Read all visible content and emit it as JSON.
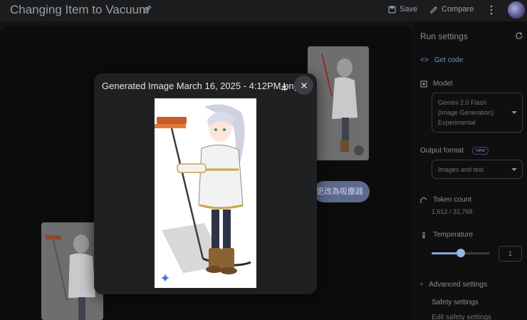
{
  "header": {
    "title": "Changing Item to Vacuum",
    "save_label": "Save",
    "compare_label": "Compare"
  },
  "chat": {
    "prompt_chip_text": "更改為吸塵器"
  },
  "run_settings": {
    "title": "Run settings",
    "get_code_label": "Get code",
    "model_label": "Model",
    "model_value_lines": [
      "Gemini 2.0 Flash",
      "(Image Generation)",
      "Experimental"
    ],
    "output_format_label": "Output format",
    "output_format_badge": "new",
    "output_format_value": "Images and text",
    "token_count_label": "Token count",
    "token_count_value": "1,612 / 32,768",
    "temperature_label": "Temperature",
    "temperature_value": "1",
    "temperature_fraction": 0.5,
    "advanced_settings_label": "Advanced settings",
    "safety_settings_label": "Safety settings",
    "edit_safety_settings_label": "Edit safety settings"
  },
  "modal": {
    "title": "Generated Image March 16, 2025 - 4:12PM.png"
  },
  "colors": {
    "accent_blue": "#6f8fc9",
    "chip_bg": "#5c6a8c",
    "modal_bg": "#1f2022"
  },
  "icons": [
    "edit-icon",
    "save-icon",
    "compare-icon",
    "more-icon",
    "refresh-icon",
    "code-icon",
    "model-icon",
    "token-icon",
    "temperature-icon",
    "chevron-icon",
    "download-icon",
    "close-icon",
    "sparkle-icon"
  ]
}
